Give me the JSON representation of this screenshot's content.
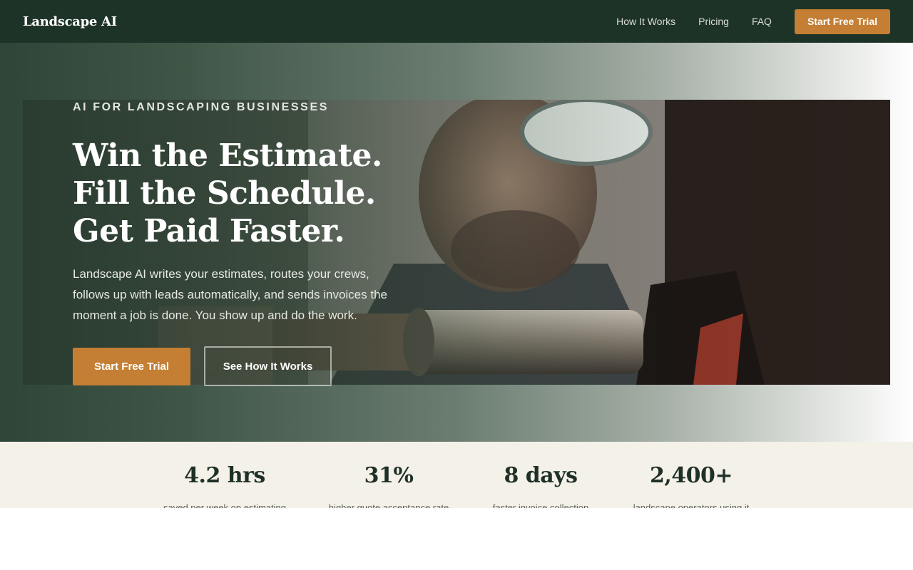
{
  "nav": {
    "brand": "Landscape AI",
    "links": [
      "How It Works",
      "Pricing",
      "FAQ"
    ],
    "cta": "Start Free Trial"
  },
  "hero": {
    "eyebrow": "AI FOR LANDSCAPING BUSINESSES",
    "headline": [
      "Win the Estimate.",
      "Fill the Schedule.",
      "Get Paid Faster."
    ],
    "subcopy": "Landscape AI writes your estimates, routes your crews, follows up with leads automatically, and sends invoices the moment a job is done. You show up and do the work.",
    "primary_cta": "Start Free Trial",
    "secondary_cta": "See How It Works"
  },
  "stats": [
    {
      "value": "4.2 hrs",
      "label": "saved per week on estimating"
    },
    {
      "value": "31%",
      "label": "higher quote acceptance rate"
    },
    {
      "value": "8 days",
      "label": "faster invoice collection"
    },
    {
      "value": "2,400+",
      "label": "landscape operators using it"
    }
  ],
  "colors": {
    "nav_bg": "#1e3327",
    "accent": "#c47f34",
    "stats_bg": "#f4f1e9",
    "stat_text": "#1f3127"
  }
}
